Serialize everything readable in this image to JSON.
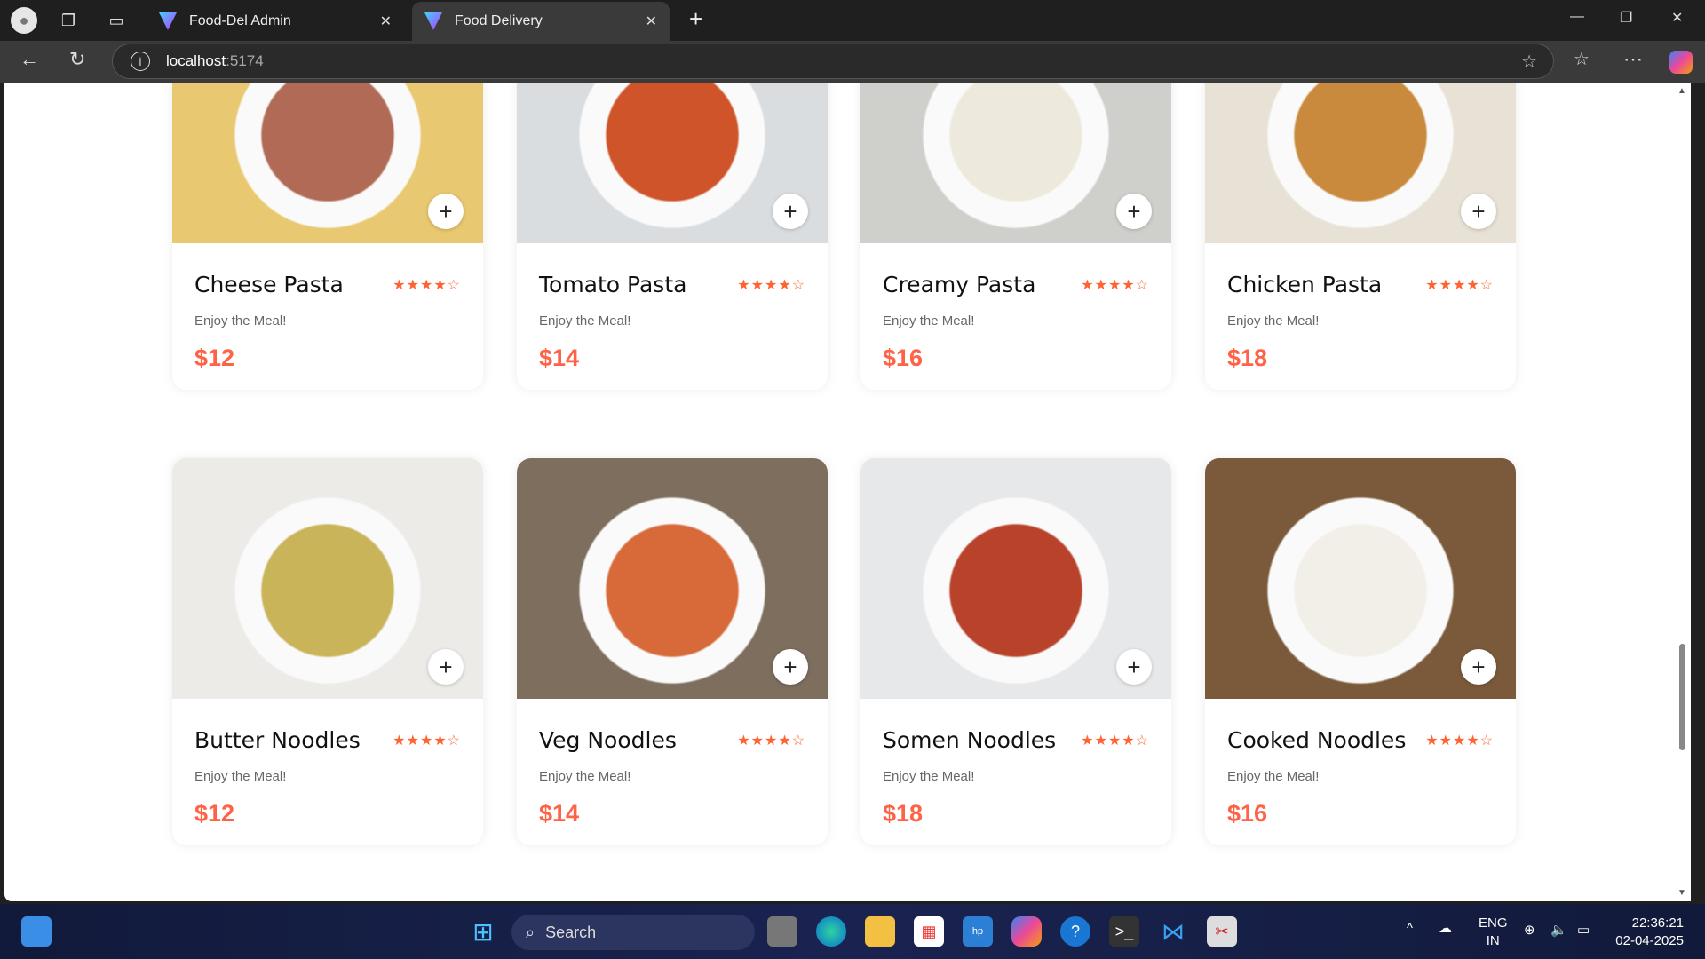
{
  "browser": {
    "tabs": [
      {
        "label": "Food-Del Admin",
        "active": false
      },
      {
        "label": "Food Delivery",
        "active": true
      }
    ],
    "url_host": "localhost",
    "url_port": ":5174"
  },
  "items": [
    {
      "name": "Cheese Pasta",
      "desc": "Enjoy the Meal!",
      "price": "$12",
      "rating": 4,
      "colors": [
        "#e8c870",
        "#b06a55"
      ]
    },
    {
      "name": "Tomato Pasta",
      "desc": "Enjoy the Meal!",
      "price": "$14",
      "rating": 4,
      "colors": [
        "#d9dde0",
        "#d0542a"
      ]
    },
    {
      "name": "Creamy Pasta",
      "desc": "Enjoy the Meal!",
      "price": "$16",
      "rating": 4,
      "colors": [
        "#cfcfcb",
        "#eee9dd"
      ]
    },
    {
      "name": "Chicken Pasta",
      "desc": "Enjoy the Meal!",
      "price": "$18",
      "rating": 4,
      "colors": [
        "#e8e2d6",
        "#c98a3e"
      ]
    },
    {
      "name": "Butter Noodles",
      "desc": "Enjoy the Meal!",
      "price": "$12",
      "rating": 4,
      "colors": [
        "#ecebe8",
        "#c9b45a"
      ]
    },
    {
      "name": "Veg Noodles",
      "desc": "Enjoy the Meal!",
      "price": "$14",
      "rating": 4,
      "colors": [
        "#7d6e5e",
        "#d86a3a"
      ]
    },
    {
      "name": "Somen Noodles",
      "desc": "Enjoy the Meal!",
      "price": "$18",
      "rating": 4,
      "colors": [
        "#e6e8ea",
        "#b8432a"
      ]
    },
    {
      "name": "Cooked Noodles",
      "desc": "Enjoy the Meal!",
      "price": "$16",
      "rating": 4,
      "colors": [
        "#7a5a3a",
        "#f2efe8"
      ]
    }
  ],
  "taskbar": {
    "search_label": "Search",
    "lang": "ENG",
    "region": "IN",
    "time": "22:36:21",
    "date": "02-04-2025"
  },
  "colors": {
    "accent": "#ff6347",
    "star": "#ff6333"
  }
}
